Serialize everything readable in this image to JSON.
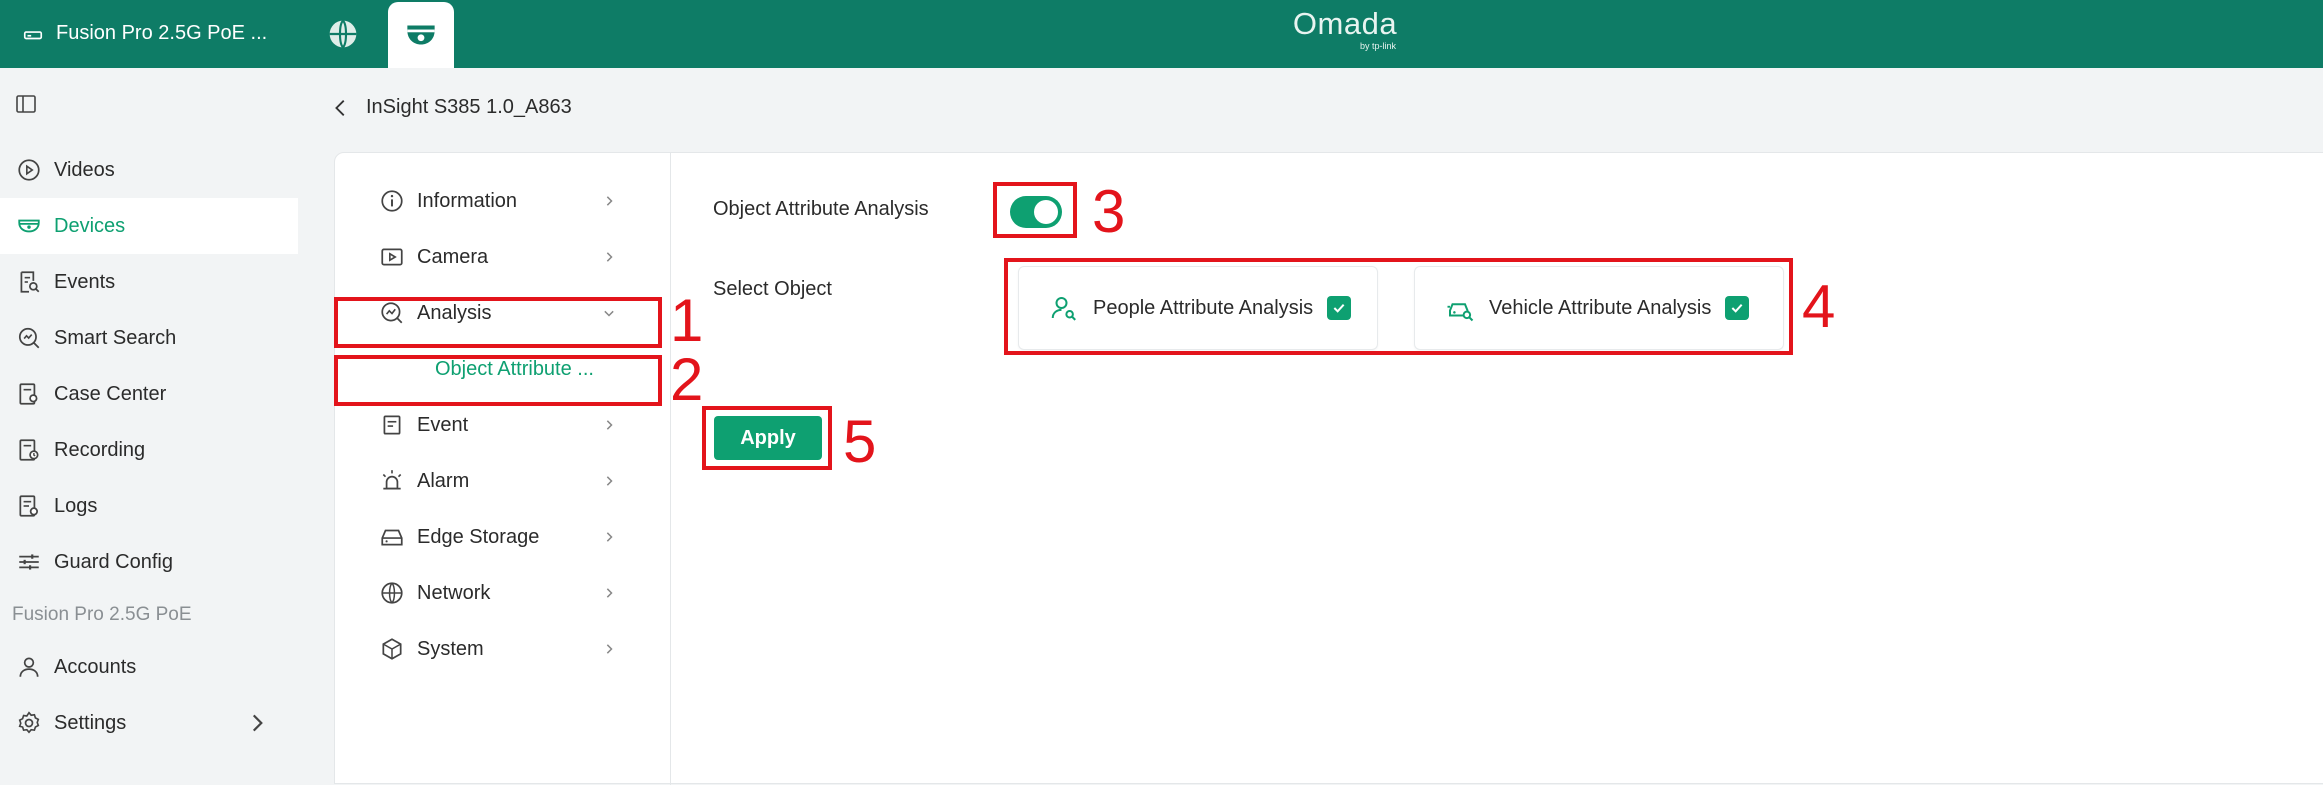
{
  "topbar": {
    "site_name": "Fusion Pro 2.5G PoE ...",
    "brand": "Omada",
    "brand_sub": "by tp-link",
    "tab_globe_icon": "globe-icon",
    "tab_camera_icon": "camera-icon"
  },
  "sidebar": {
    "items": [
      {
        "label": "Videos",
        "icon": "play-circle-icon"
      },
      {
        "label": "Devices",
        "icon": "dome-camera-icon",
        "active": true
      },
      {
        "label": "Events",
        "icon": "event-search-icon"
      },
      {
        "label": "Smart Search",
        "icon": "smart-search-icon"
      },
      {
        "label": "Case Center",
        "icon": "case-icon"
      },
      {
        "label": "Recording",
        "icon": "recording-icon"
      },
      {
        "label": "Logs",
        "icon": "logs-icon"
      },
      {
        "label": "Guard Config",
        "icon": "sliders-icon"
      }
    ],
    "section_label": "Fusion Pro 2.5G PoE",
    "bottom_items": [
      {
        "label": "Accounts",
        "icon": "user-icon"
      },
      {
        "label": "Settings",
        "icon": "gear-icon"
      }
    ]
  },
  "breadcrumb": {
    "title": "InSight S385 1.0_A863"
  },
  "menu": {
    "items": [
      {
        "label": "Information",
        "icon": "info-icon"
      },
      {
        "label": "Camera",
        "icon": "camera-play-icon"
      },
      {
        "label": "Analysis",
        "icon": "analysis-icon",
        "expanded": true
      },
      {
        "label": "Event",
        "icon": "event-icon"
      },
      {
        "label": "Alarm",
        "icon": "alarm-icon"
      },
      {
        "label": "Edge Storage",
        "icon": "storage-icon"
      },
      {
        "label": "Network",
        "icon": "globe-icon"
      },
      {
        "label": "System",
        "icon": "cube-icon"
      }
    ],
    "submenu_label": "Object Attribute ..."
  },
  "content": {
    "object_attribute_label": "Object Attribute Analysis",
    "toggle_on": true,
    "select_object_label": "Select Object",
    "people_label": "People Attribute Analysis",
    "people_checked": true,
    "vehicle_label": "Vehicle Attribute Analysis",
    "vehicle_checked": true,
    "apply_label": "Apply"
  },
  "annotations": [
    "1",
    "2",
    "3",
    "4",
    "5"
  ],
  "colors": {
    "topbar": "#0e7c66",
    "accent": "#0ea071",
    "annotation": "#e3141b",
    "background": "#f2f4f5"
  }
}
